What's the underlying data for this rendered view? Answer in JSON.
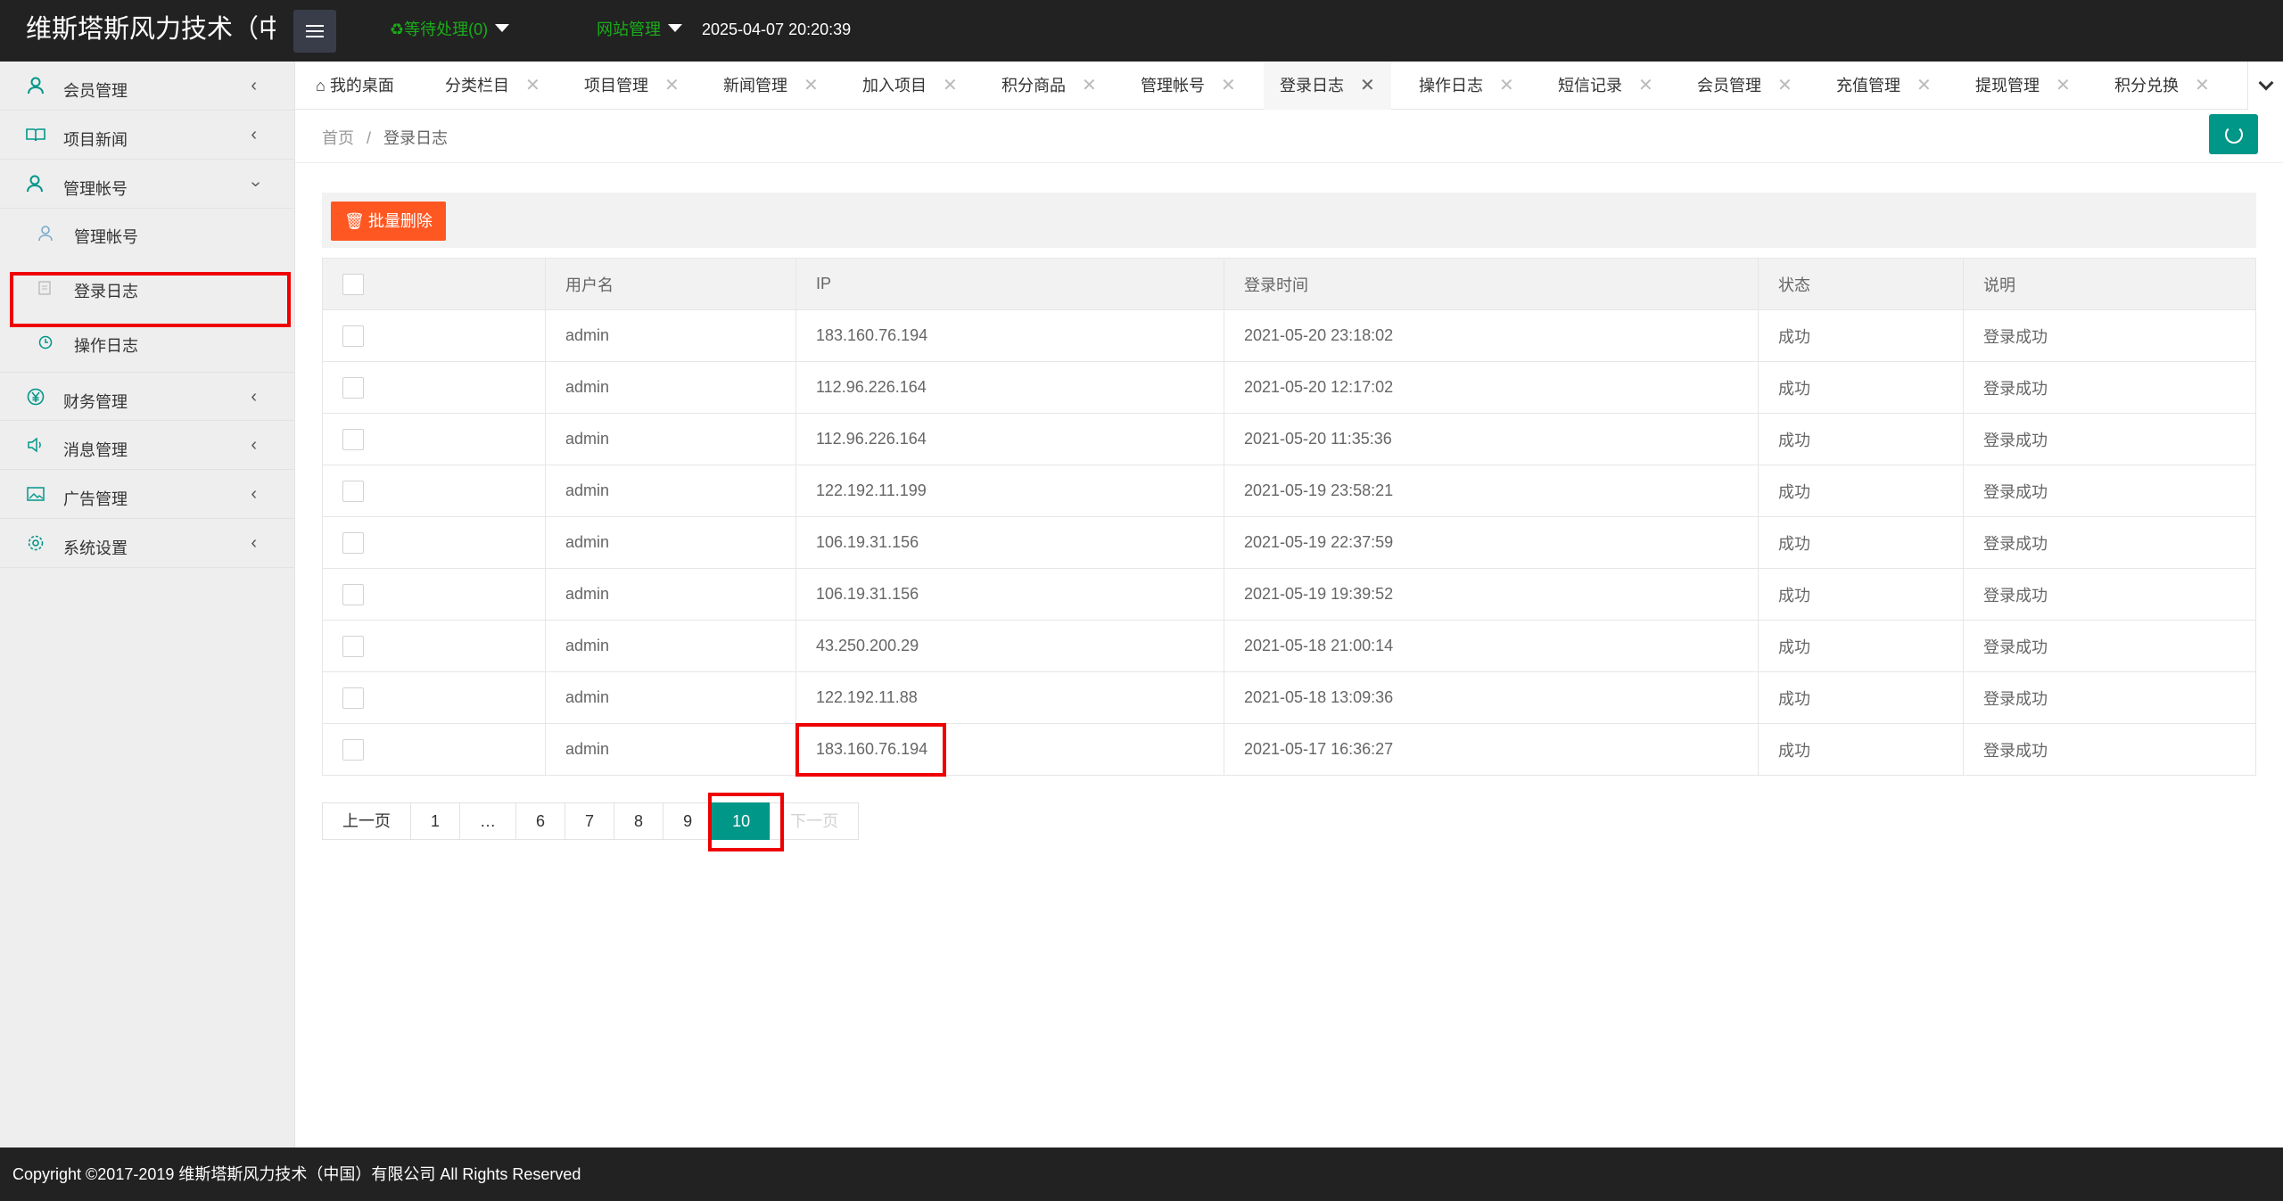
{
  "header": {
    "brand": "维斯塔斯风力技术（中",
    "pending_label": "♻等待处理(0)",
    "site_manage_label": "网站管理",
    "datetime": "2025-04-07 20:20:39"
  },
  "sidebar": {
    "items": [
      {
        "label": "会员管理",
        "icon": "user-icon"
      },
      {
        "label": "项目新闻",
        "icon": "book-icon"
      },
      {
        "label": "管理帐号",
        "icon": "admin-icon"
      },
      {
        "label": "财务管理",
        "icon": "yen-icon"
      },
      {
        "label": "消息管理",
        "icon": "speaker-icon"
      },
      {
        "label": "广告管理",
        "icon": "image-icon"
      },
      {
        "label": "系统设置",
        "icon": "gear-icon"
      }
    ],
    "sub_items": [
      {
        "label": "管理帐号",
        "icon": "user-icon"
      },
      {
        "label": "登录日志",
        "icon": "document-icon"
      },
      {
        "label": "操作日志",
        "icon": "clock-icon"
      }
    ]
  },
  "tabs": [
    {
      "label": "我的桌面",
      "icon": "home-icon"
    },
    {
      "label": "分类栏目"
    },
    {
      "label": "项目管理"
    },
    {
      "label": "新闻管理"
    },
    {
      "label": "加入项目"
    },
    {
      "label": "积分商品"
    },
    {
      "label": "管理帐号"
    },
    {
      "label": "登录日志",
      "active": true
    },
    {
      "label": "操作日志"
    },
    {
      "label": "短信记录"
    },
    {
      "label": "会员管理"
    },
    {
      "label": "充值管理"
    },
    {
      "label": "提现管理"
    },
    {
      "label": "积分兑换"
    }
  ],
  "breadcrumb": {
    "home": "首页",
    "separator": "/",
    "current": "登录日志"
  },
  "toolbar": {
    "batch_delete_label": "批量删除"
  },
  "table": {
    "columns": [
      "用户名",
      "IP",
      "登录时间",
      "状态",
      "说明"
    ],
    "rows": [
      {
        "username": "admin",
        "ip": "183.160.76.194",
        "time": "2021-05-20 23:18:02",
        "status": "成功",
        "note": "登录成功"
      },
      {
        "username": "admin",
        "ip": "112.96.226.164",
        "time": "2021-05-20 12:17:02",
        "status": "成功",
        "note": "登录成功"
      },
      {
        "username": "admin",
        "ip": "112.96.226.164",
        "time": "2021-05-20 11:35:36",
        "status": "成功",
        "note": "登录成功"
      },
      {
        "username": "admin",
        "ip": "122.192.11.199",
        "time": "2021-05-19 23:58:21",
        "status": "成功",
        "note": "登录成功"
      },
      {
        "username": "admin",
        "ip": "106.19.31.156",
        "time": "2021-05-19 22:37:59",
        "status": "成功",
        "note": "登录成功"
      },
      {
        "username": "admin",
        "ip": "106.19.31.156",
        "time": "2021-05-19 19:39:52",
        "status": "成功",
        "note": "登录成功"
      },
      {
        "username": "admin",
        "ip": "43.250.200.29",
        "time": "2021-05-18 21:00:14",
        "status": "成功",
        "note": "登录成功"
      },
      {
        "username": "admin",
        "ip": "122.192.11.88",
        "time": "2021-05-18 13:09:36",
        "status": "成功",
        "note": "登录成功"
      },
      {
        "username": "admin",
        "ip": "183.160.76.194",
        "time": "2021-05-17 16:36:27",
        "status": "成功",
        "note": "登录成功"
      }
    ]
  },
  "pagination": {
    "prev": "上一页",
    "pages": [
      "1",
      "…",
      "6",
      "7",
      "8",
      "9",
      "10"
    ],
    "current": "10",
    "next": "下一页"
  },
  "footer": {
    "copyright": "Copyright ©2017-2019 维斯塔斯风力技术（中国）有限公司 All Rights Reserved"
  },
  "colors": {
    "accent": "#009688",
    "danger": "#ff5722",
    "header_bg": "#222222",
    "highlight": "#ee0000"
  }
}
